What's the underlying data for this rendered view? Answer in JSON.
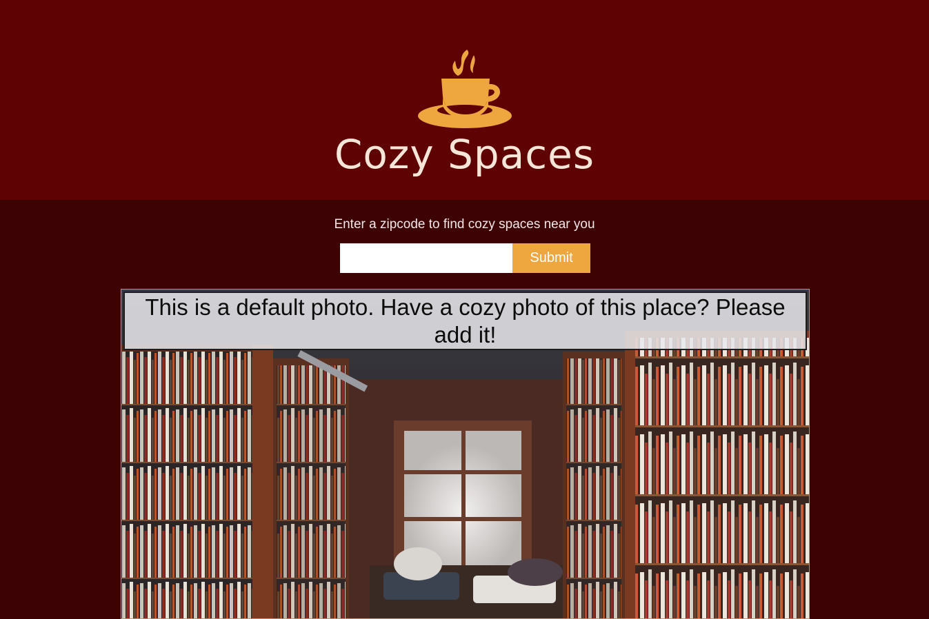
{
  "header": {
    "logo_icon": "coffee-cup-icon",
    "title": "Cozy Spaces",
    "colors": {
      "background": "#5e0204",
      "logo": "#eea63f",
      "title": "#f6e6d8"
    }
  },
  "search": {
    "prompt": "Enter a zipcode to find cozy spaces near you",
    "zip_value": "",
    "placeholder": "",
    "submit_label": "Submit",
    "colors": {
      "button": "#eea63f",
      "page_background": "#3d0204"
    }
  },
  "photo": {
    "caption": "This is a default photo.  Have a cozy photo of this place? Please add it!",
    "subject": "bookstore-reading-nook-photo"
  }
}
